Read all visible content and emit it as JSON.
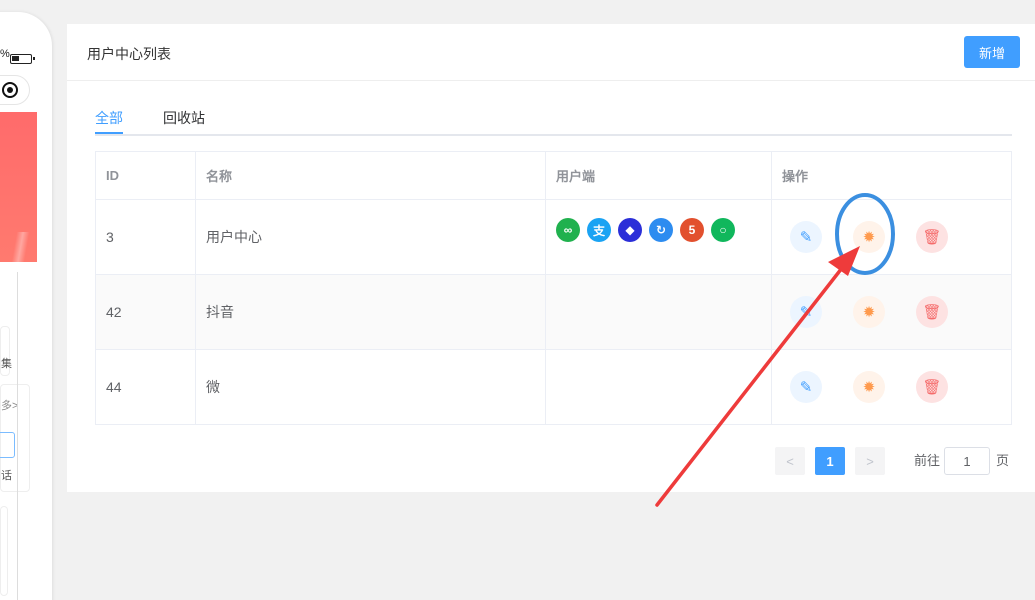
{
  "phone": {
    "status": "%",
    "card1_text": "集",
    "card2_more": "多>",
    "card2_text": "话"
  },
  "panel": {
    "title": "用户中心列表",
    "new_button": "新增"
  },
  "tabs": [
    {
      "label": "全部",
      "active": true
    },
    {
      "label": "回收站",
      "active": false
    }
  ],
  "table": {
    "columns": [
      "ID",
      "名称",
      "用户端",
      "操作"
    ],
    "rows": [
      {
        "id": "3",
        "name": "用户中心",
        "clients": [
          "wechat-miniprogram-icon",
          "alipay-icon",
          "baidu-icon",
          "bytedance-icon",
          "html5-icon",
          "wechat-official-icon"
        ]
      },
      {
        "id": "42",
        "name": "抖音",
        "clients": []
      },
      {
        "id": "44",
        "name": "微",
        "clients": []
      }
    ]
  },
  "pagination": {
    "prev": "<",
    "current": "1",
    "next": ">",
    "goto_label": "前往",
    "goto_value": "1",
    "page_suffix": "页"
  },
  "colors": {
    "accent": "#409eff",
    "annotation_circle": "#3b8fe0",
    "annotation_arrow": "#ee3b3b"
  }
}
